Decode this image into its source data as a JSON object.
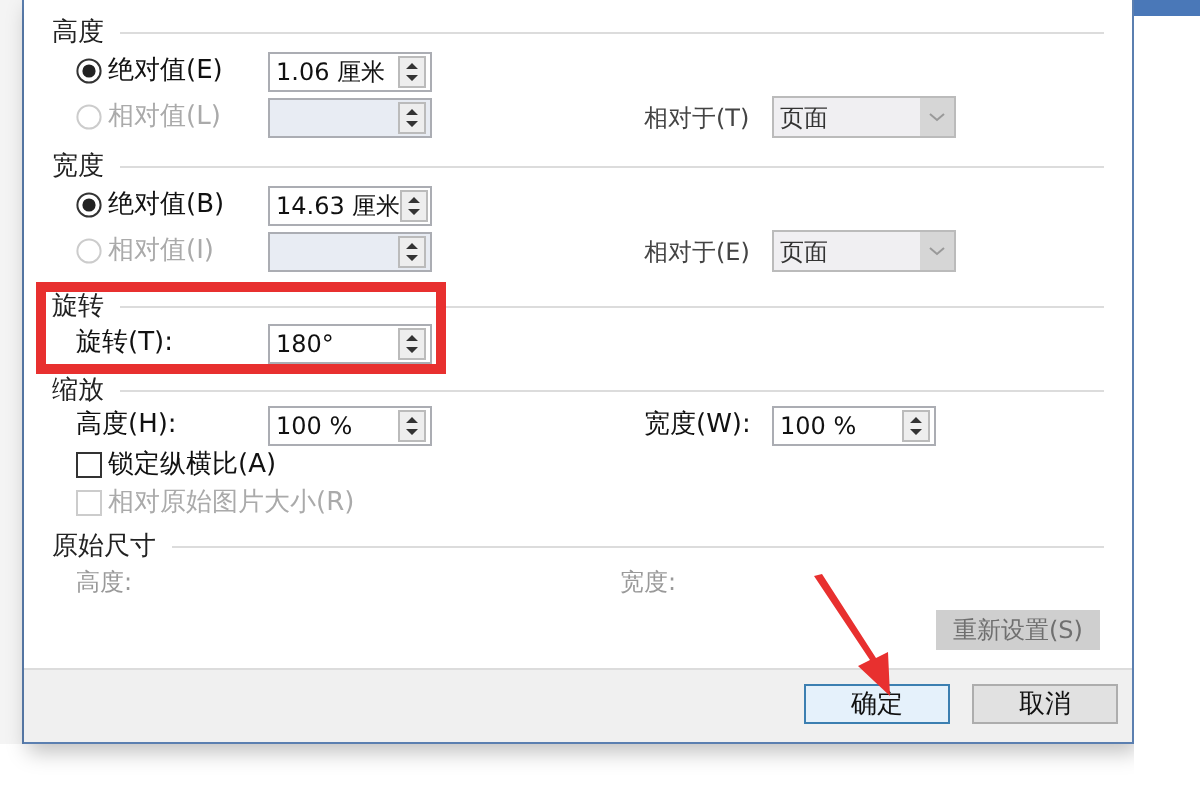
{
  "dialog": {
    "height": {
      "title": "高度",
      "absolute": {
        "label": "绝对值(E)",
        "selected": true,
        "value": "1.06 厘米"
      },
      "relative": {
        "label": "相对值(L)",
        "selected": false,
        "disabled": true,
        "relative_to_label": "相对于(T)",
        "relative_to_value": "页面"
      }
    },
    "width": {
      "title": "宽度",
      "absolute": {
        "label": "绝对值(B)",
        "selected": true,
        "value": "14.63 厘米"
      },
      "relative": {
        "label": "相对值(I)",
        "selected": false,
        "disabled": true,
        "relative_to_label": "相对于(E)",
        "relative_to_value": "页面"
      }
    },
    "rotation": {
      "title": "旋转",
      "label": "旋转(T):",
      "value": "180°"
    },
    "scale": {
      "title": "缩放",
      "height_label": "高度(H):",
      "height_value": "100 %",
      "width_label": "宽度(W):",
      "width_value": "100 %",
      "lock_aspect": {
        "label": "锁定纵横比(A)",
        "checked": false,
        "disabled": false
      },
      "relative_original": {
        "label": "相对原始图片大小(R)",
        "checked": false,
        "disabled": true
      }
    },
    "original_size": {
      "title": "原始尺寸",
      "height_label": "高度:",
      "width_label": "宽度:",
      "reset_button": {
        "label": "重新设置(S)",
        "disabled": true
      }
    },
    "buttons": [
      {
        "label": "确定",
        "default": true
      },
      {
        "label": "取消",
        "default": false
      }
    ]
  }
}
